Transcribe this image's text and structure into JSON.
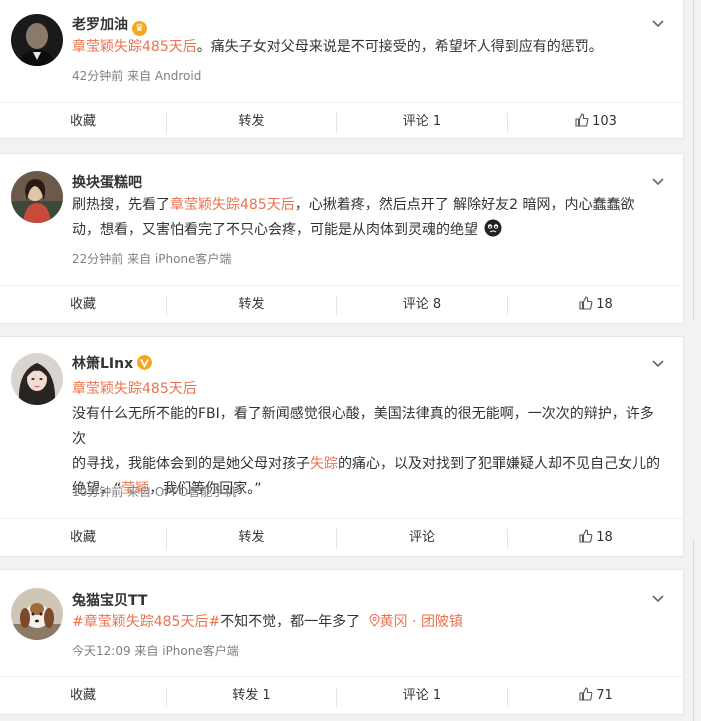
{
  "posts": [
    {
      "username": "老罗加油",
      "badge": "crown-badge-icon",
      "topic": "章莹颖失踪485天后",
      "text": "。痛失子女对父母来说是不可接受的，希望坏人得到应有的惩罚。",
      "time": "42分钟前",
      "source": "来自 Android",
      "actions": {
        "collect": "收藏",
        "forward": "转发",
        "comment": "评论 1",
        "like": "103"
      }
    },
    {
      "username": "换块蛋糕吧",
      "text_a": "刷热搜，先看了",
      "topic": "章莹颖失踪485天后",
      "text_b": "，心揪着疼，然后点开了 解除好友2 暗网，内心蠢蠢欲",
      "text_c": "动，想看，又害怕看完了不只心会疼，可能是从肉体到灵魂的绝望",
      "emoji": "crying-emoji-icon",
      "time": "22分钟前",
      "source": "来自 iPhone客户端",
      "actions": {
        "collect": "收藏",
        "forward": "转发",
        "comment": "评论 8",
        "like": "18"
      }
    },
    {
      "username": "林箫LInx",
      "badge": "verified-v-badge-icon",
      "topic": "章莹颖失踪485天后",
      "line1": "没有什么无所不能的FBI，看了新闻感觉很心酸，美国法律真的很无能啊，一次次的辩护，许多次",
      "line2a": "的寻找，我能体会到的是她父母对孩子",
      "line2_hl": "失踪",
      "line2b": "的痛心，以及对找到了犯罪嫌疑人却不见自己女儿的",
      "line3a": "绝望，“",
      "line3_hl": "莹颖",
      "line3b": "，我们等你回家。”",
      "time": "10分钟前",
      "source": "来自 OPPO智能手机",
      "actions": {
        "collect": "收藏",
        "forward": "转发",
        "comment": "评论",
        "like": "18"
      }
    },
    {
      "username": "兔猫宝贝TT",
      "topic": "#章莹颖失踪485天后#",
      "text": "不知不觉，都一年多了",
      "location": "黄冈 · 团陂镇",
      "time": "今天12:09",
      "source": "来自 iPhone客户端",
      "actions": {
        "collect": "收藏",
        "forward": "转发 1",
        "comment": "评论 1",
        "like": "71"
      }
    }
  ],
  "colors": {
    "highlight": "#eb7350",
    "text": "#333333",
    "meta": "#808080",
    "verified": "#f5a623"
  }
}
